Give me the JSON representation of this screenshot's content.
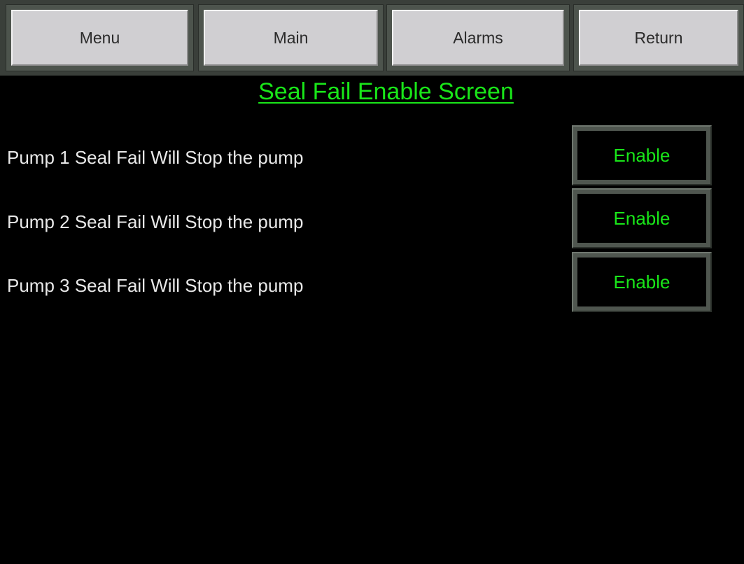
{
  "nav": {
    "menu_label": "Menu",
    "main_label": "Main",
    "alarms_label": "Alarms",
    "return_label": "Return"
  },
  "screen": {
    "title": "Seal Fail Enable Screen"
  },
  "rows": [
    {
      "label": "Pump 1 Seal Fail Will Stop the pump",
      "button": "Enable"
    },
    {
      "label": "Pump 2 Seal Fail Will Stop the pump",
      "button": "Enable"
    },
    {
      "label": "Pump 3 Seal Fail Will Stop the pump",
      "button": "Enable"
    }
  ],
  "colors": {
    "background": "#000000",
    "accent_green": "#19e619",
    "nav_button_face": "#d0cfd2",
    "frame": "#4f564f"
  }
}
